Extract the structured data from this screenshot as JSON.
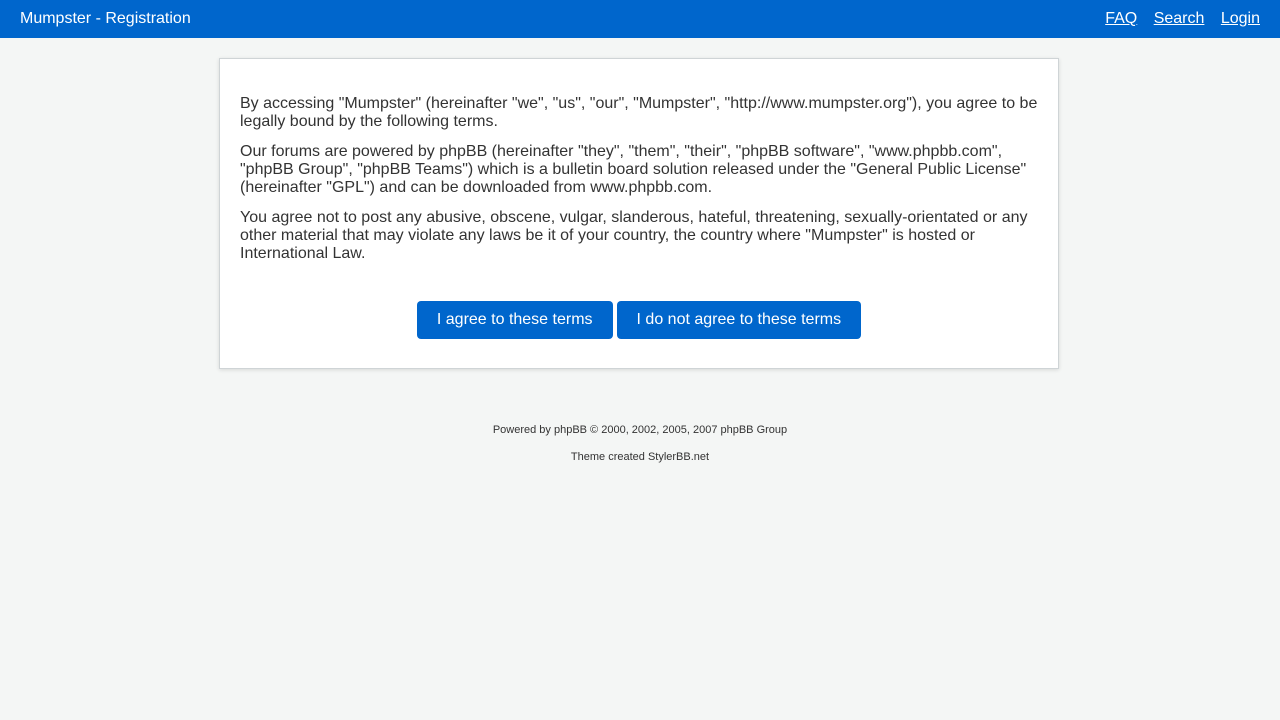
{
  "header": {
    "title": "Mumpster - Registration",
    "nav": {
      "faq": "FAQ",
      "search": "Search",
      "login": "Login"
    }
  },
  "terms": {
    "paragraphs": [
      "By accessing \"Mumpster\" (hereinafter \"we\", \"us\", \"our\", \"Mumpster\", \"http://www.mumpster.org\"), you agree to be legally bound by the following terms.",
      "Our forums are powered by phpBB (hereinafter \"they\", \"them\", \"their\", \"phpBB software\", \"www.phpbb.com\", \"phpBB Group\", \"phpBB Teams\") which is a bulletin board solution released under the \"General Public License\" (hereinafter \"GPL\") and can be downloaded from www.phpbb.com.",
      "You agree not to post any abusive, obscene, vulgar, slanderous, hateful, threatening, sexually-orientated or any other material that may violate any laws be it of your country, the country where \"Mumpster\" is hosted or International Law."
    ],
    "agree_label": "I agree to these terms",
    "disagree_label": "I do not agree to these terms"
  },
  "footer": {
    "powered_by": "Powered by phpBB © 2000, 2002, 2005, 2007 phpBB Group",
    "theme": "Theme created StylerBB.net"
  },
  "colors": {
    "accent": "#0066cc",
    "background": "#f4f6f5"
  }
}
